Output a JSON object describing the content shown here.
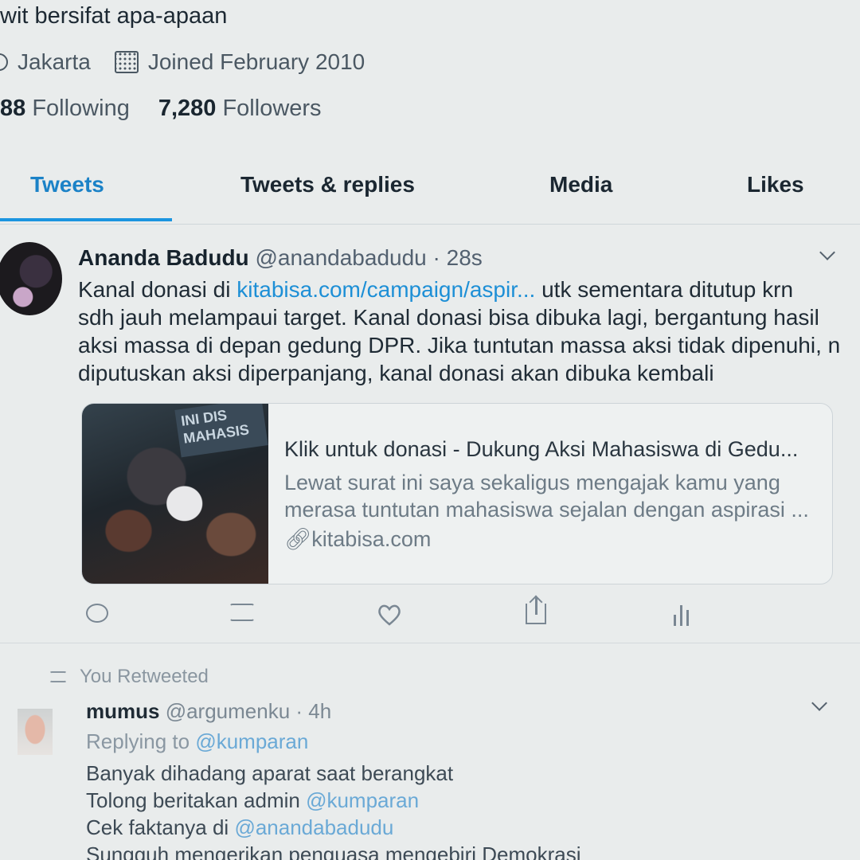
{
  "profile": {
    "bio": "wit bersifat apa-apaan",
    "location": "Jakarta",
    "joined": "Joined February 2010",
    "following_count": "88",
    "following_label": "Following",
    "followers_count": "7,280",
    "followers_label": "Followers"
  },
  "tabs": [
    {
      "label": "Tweets"
    },
    {
      "label": "Tweets & replies"
    },
    {
      "label": "Media"
    },
    {
      "label": "Likes"
    }
  ],
  "tweet1": {
    "name": "Ananda Badudu",
    "handle": "@anandabadudu",
    "time": "· 28s",
    "body": {
      "l1a": "Kanal donasi di ",
      "l1link": "kitabisa.com/campaign/aspir...",
      "l1b": " utk sementara ditutup krn",
      "l2": "sdh jauh melampaui target. Kanal donasi bisa dibuka lagi, bergantung hasil",
      "l3": "aksi massa di depan gedung DPR. Jika tuntutan massa aksi tidak dipenuhi, n",
      "l4": "diputuskan aksi diperpanjang, kanal donasi akan dibuka kembali"
    },
    "card": {
      "image_sign": "INI DIS MAHASIS",
      "title": "Klik untuk donasi - Dukung Aksi Mahasiswa di Gedu...",
      "desc1": "Lewat surat ini saya sekaligus mengajak kamu yang",
      "desc2": "merasa tuntutan mahasiswa sejalan dengan aspirasi ...",
      "url": "kitabisa.com"
    }
  },
  "retweet_label": "You Retweeted",
  "tweet2": {
    "name": "mumus",
    "handle": "@argumenku",
    "time": "· 4h",
    "replying_prefix": "Replying to ",
    "replying_to": "@kumparan",
    "line1": "Banyak dihadang aparat saat berangkat",
    "line2_prefix": "Tolong beritakan admin ",
    "line2_mention": "@kumparan",
    "line3_prefix": "Cek faktanya di ",
    "line3_mention": "@anandabadudu",
    "line4": "Sungguh mengerikan penguasa mengebiri Demokrasi"
  },
  "icons": [
    "location-pin-icon",
    "calendar-icon",
    "chevron-down-icon",
    "reply-icon",
    "retweet-icon",
    "like-icon",
    "share-icon",
    "analytics-icon",
    "link-icon"
  ],
  "colors": {
    "accent": "#1b95e0",
    "link": "#1d8fd6",
    "background": "#e9ecec"
  }
}
